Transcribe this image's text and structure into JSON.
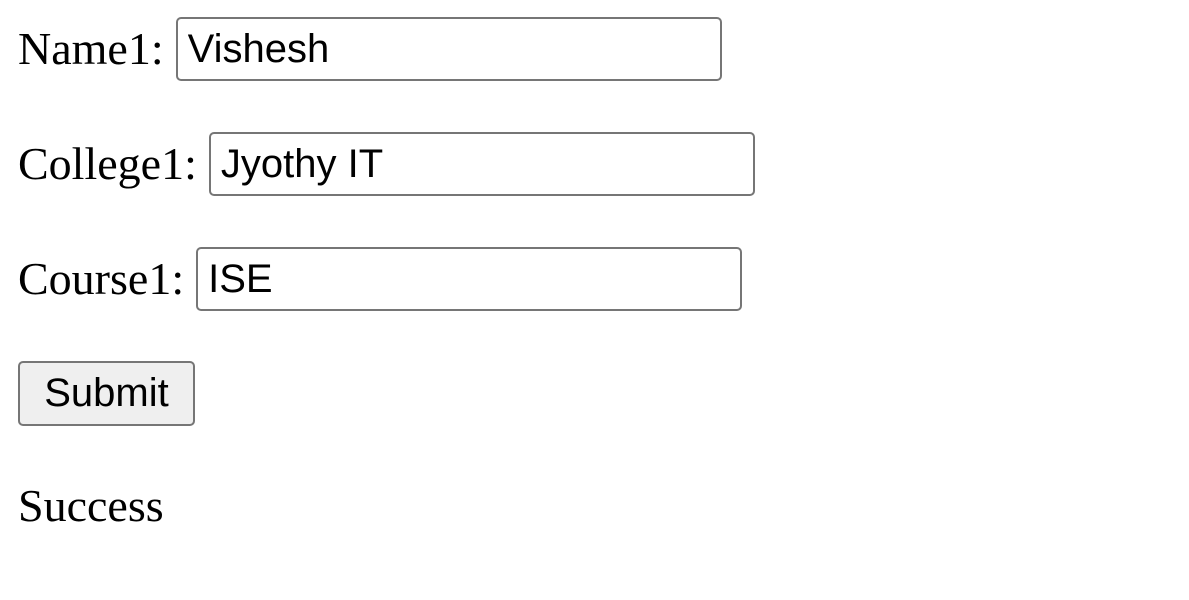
{
  "form": {
    "fields": [
      {
        "label": "Name1:",
        "value": "Vishesh"
      },
      {
        "label": "College1:",
        "value": "Jyothy IT"
      },
      {
        "label": "Course1:",
        "value": "ISE"
      }
    ],
    "submit_label": "Submit"
  },
  "status": {
    "message": "Success"
  }
}
